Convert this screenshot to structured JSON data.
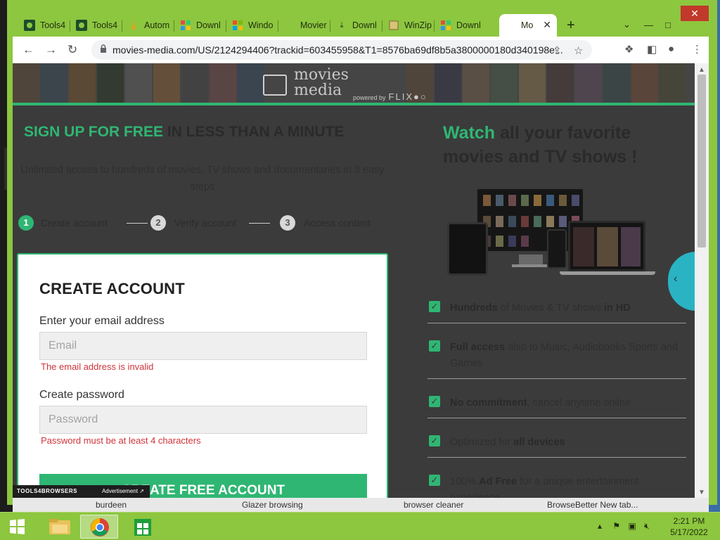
{
  "browser": {
    "tabs": [
      {
        "title": "Tools4",
        "icon": "tools4-favicon"
      },
      {
        "title": "Tools4",
        "icon": "tools4-favicon"
      },
      {
        "title": "Autom",
        "icon": "autom-favicon"
      },
      {
        "title": "Downl",
        "icon": "download-site-favicon"
      },
      {
        "title": "Windo",
        "icon": "windows-logo-favicon"
      },
      {
        "title": "Movier",
        "icon": "blank-favicon"
      },
      {
        "title": "Downl",
        "icon": "download-arrow-icon"
      },
      {
        "title": "WinZip",
        "icon": "winzip-favicon"
      },
      {
        "title": "Downl",
        "icon": "download-site-favicon"
      },
      {
        "title": "Mo",
        "icon": "blank-favicon"
      }
    ],
    "url_host": "movies-media.com",
    "url_path": "/US/2124294406?trackid=603455958&T1=8576ba69df8b5a3800000180d340198e..."
  },
  "page": {
    "brand_line1": "movies",
    "brand_line2": "media",
    "powered_by": "powered by",
    "powered_brand": "FLIX●○",
    "signup_heading_green": "SIGN UP FOR FREE",
    "signup_heading_rest": " IN LESS THAN A MINUTE",
    "signup_sub": "Unlimited access to hundreds of movies, TV shows and documentaries in 3 easy steps",
    "steps": [
      {
        "num": "1",
        "label": "Create account"
      },
      {
        "num": "2",
        "label": "Verify account"
      },
      {
        "num": "3",
        "label": "Access content"
      }
    ],
    "form": {
      "title": "CREATE ACCOUNT",
      "email_label": "Enter your email address",
      "email_placeholder": "Email",
      "email_error": "The email address is invalid",
      "password_label": "Create password",
      "password_placeholder": "Password",
      "password_error": "Password must be at least 4 characters",
      "submit_label": "CREATE FREE ACCOUNT"
    },
    "ad": {
      "brand": "TOOLS4BROWSERS",
      "label": "Advertisement ↗"
    },
    "watch_heading_green": "Watch",
    "watch_heading_rest": " all your favorite movies and TV shows !",
    "features": [
      {
        "bold1": "Hundreds",
        "text": " of Movies & TV shows ",
        "bold2": "in HD"
      },
      {
        "bold1": "Full access",
        "text": " also to Music, Audiobooks Sports and Games",
        "bold2": ""
      },
      {
        "bold1": "No commitment",
        "text": ", cancel anytime online",
        "bold2": ""
      },
      {
        "bold1": "",
        "text": "Optimized for ",
        "bold2": "all devices"
      },
      {
        "bold1": "",
        "text": "100% ",
        "bold2": "Ad Free",
        "text2": " for a unique entertainment experience"
      }
    ]
  },
  "desktop_under": [
    "burdeen",
    "Glazer browsing",
    "browser cleaner",
    "BrowseBetter New tab..."
  ],
  "taskbar": {
    "time": "2:21 PM",
    "date": "5/17/2022"
  },
  "colors": {
    "accent_green": "#2fb673",
    "chrome_frame": "#8dc63f",
    "error_red": "#d0333a"
  }
}
